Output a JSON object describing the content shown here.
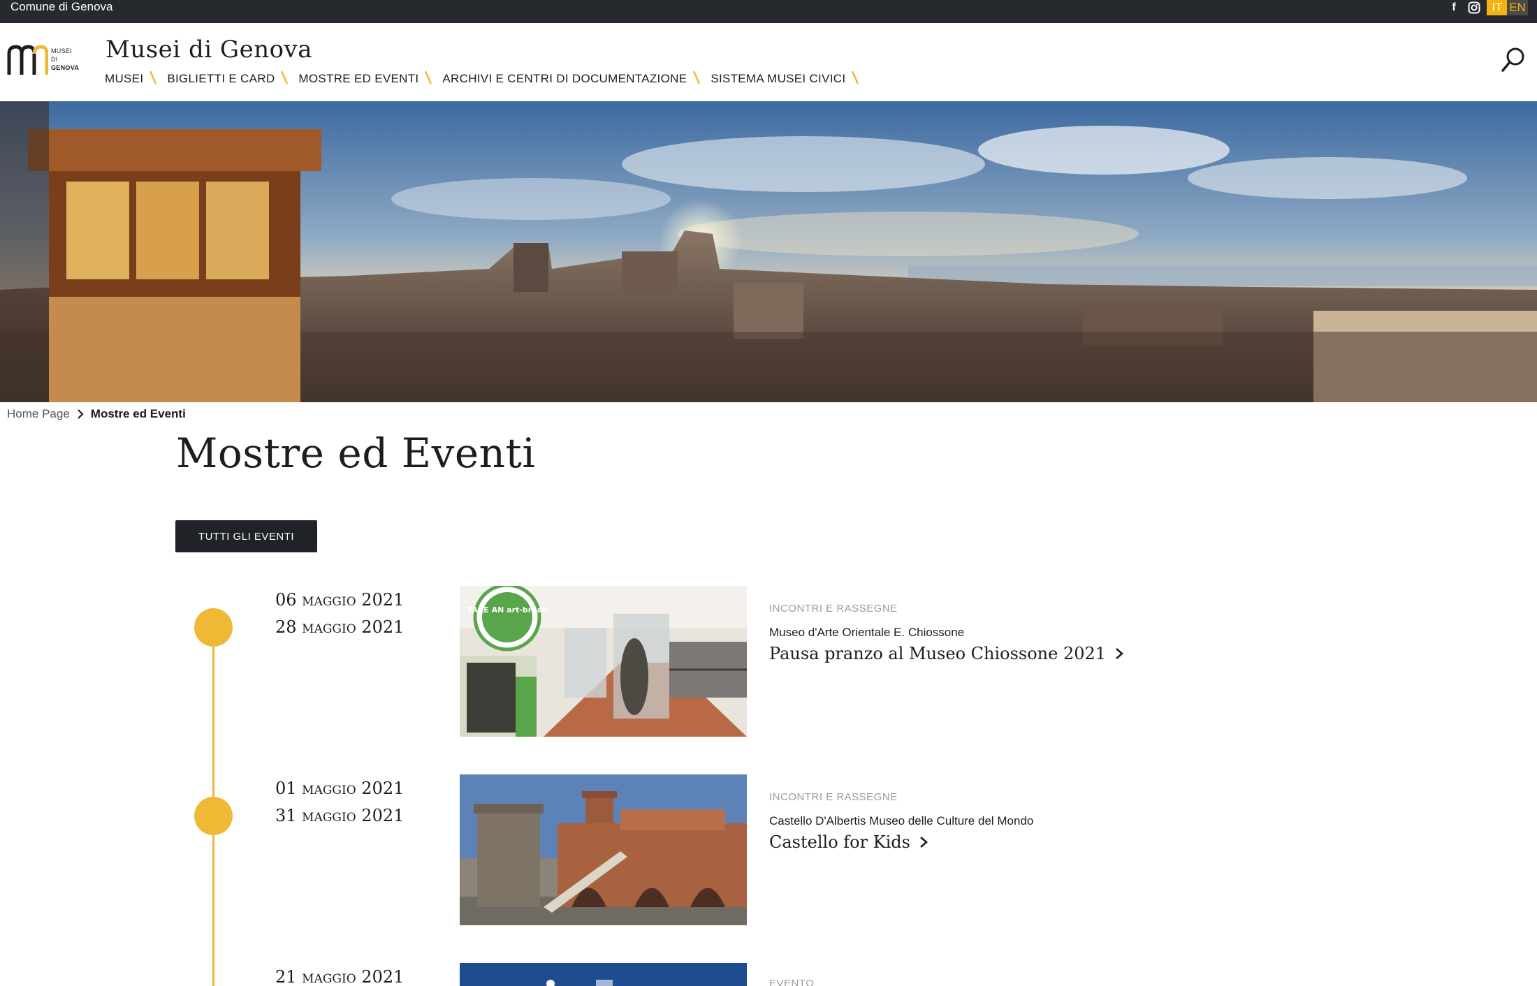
{
  "topbar": {
    "comune": "Comune di Genova",
    "social": [
      {
        "name": "facebook-icon",
        "glyph": "f"
      },
      {
        "name": "instagram-icon",
        "glyph": "◙"
      }
    ],
    "languages": [
      {
        "code": "IT",
        "active": true
      },
      {
        "code": "EN",
        "active": false
      }
    ]
  },
  "header": {
    "logo_lines": [
      "MUSEI",
      "DI",
      "GENOVA"
    ],
    "site_title": "Musei di Genova",
    "nav": [
      "MUSEI",
      "BIGLIETTI E CARD",
      "MOSTRE ED EVENTI",
      "ARCHIVI E CENTRI DI DOCUMENTAZIONE",
      "SISTEMA MUSEI CIVICI"
    ]
  },
  "breadcrumb": {
    "home": "Home Page",
    "current": "Mostre ed Eventi"
  },
  "page": {
    "title": "Mostre ed Eventi",
    "all_events_button": "TUTTI GLI EVENTI"
  },
  "events": [
    {
      "date_start": "06 maggio 2021",
      "date_end": "28 maggio 2021",
      "category": "INCONTRI E RASSEGNE",
      "place": "Museo d'Arte Orientale E. Chiossone",
      "title": "Pausa pranzo al Museo Chiossone 2021",
      "image_badge": "TAKE AN art-break"
    },
    {
      "date_start": "01 maggio 2021",
      "date_end": "31 maggio 2021",
      "category": "INCONTRI E RASSEGNE",
      "place": "Castello D'Albertis Museo delle Culture del Mondo",
      "title": "Castello for Kids"
    },
    {
      "date_start": "21 maggio 2021",
      "category": "EVENTO"
    }
  ],
  "colors": {
    "accent": "#f0b935",
    "topbar": "#262a2e",
    "button": "#1f2327"
  }
}
